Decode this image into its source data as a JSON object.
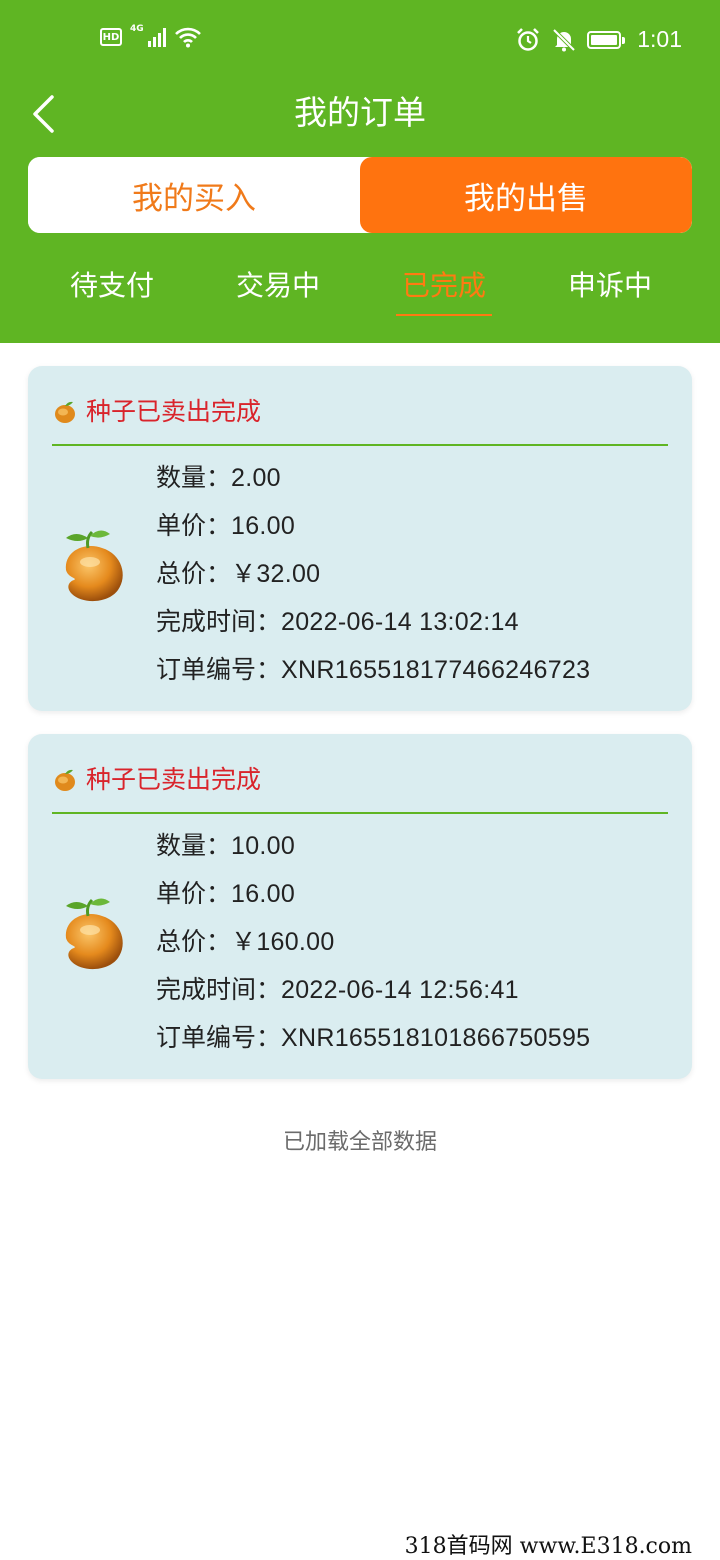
{
  "status_bar": {
    "hd": "HD",
    "network": "4G",
    "time": "1:01"
  },
  "header": {
    "title": "我的订单",
    "segments": [
      {
        "label": "我的买入",
        "active": false
      },
      {
        "label": "我的出售",
        "active": true
      }
    ],
    "tabs": [
      {
        "label": "待支付",
        "active": false
      },
      {
        "label": "交易中",
        "active": false
      },
      {
        "label": "已完成",
        "active": true
      },
      {
        "label": "申诉中",
        "active": false
      }
    ]
  },
  "orders": [
    {
      "status": "种子已卖出完成",
      "quantity_label": "数量：",
      "quantity": "2.00",
      "unit_price_label": "单价：",
      "unit_price": "16.00",
      "total_label": "总价：",
      "total": "￥32.00",
      "completed_label": "完成时间：",
      "completed_at": "2022-06-14 13:02:14",
      "order_no_label": "订单编号：",
      "order_no": "XNR1655181774662467 23"
    },
    {
      "status": "种子已卖出完成",
      "quantity_label": "数量：",
      "quantity": "10.00",
      "unit_price_label": "单价：",
      "unit_price": "16.00",
      "total_label": "总价：",
      "total": "￥160.00",
      "completed_label": "完成时间：",
      "completed_at": "2022-06-14 12:56:41",
      "order_no_label": "订单编号：",
      "order_no": "XNR165518101866750595"
    }
  ],
  "footer_note": "已加载全部数据",
  "watermark": "318首码网 www.E318.com",
  "colors": {
    "header_green": "#5fb523",
    "accent_orange": "#ff730f",
    "card_bg": "#daedf0",
    "status_red": "#d9242b"
  }
}
